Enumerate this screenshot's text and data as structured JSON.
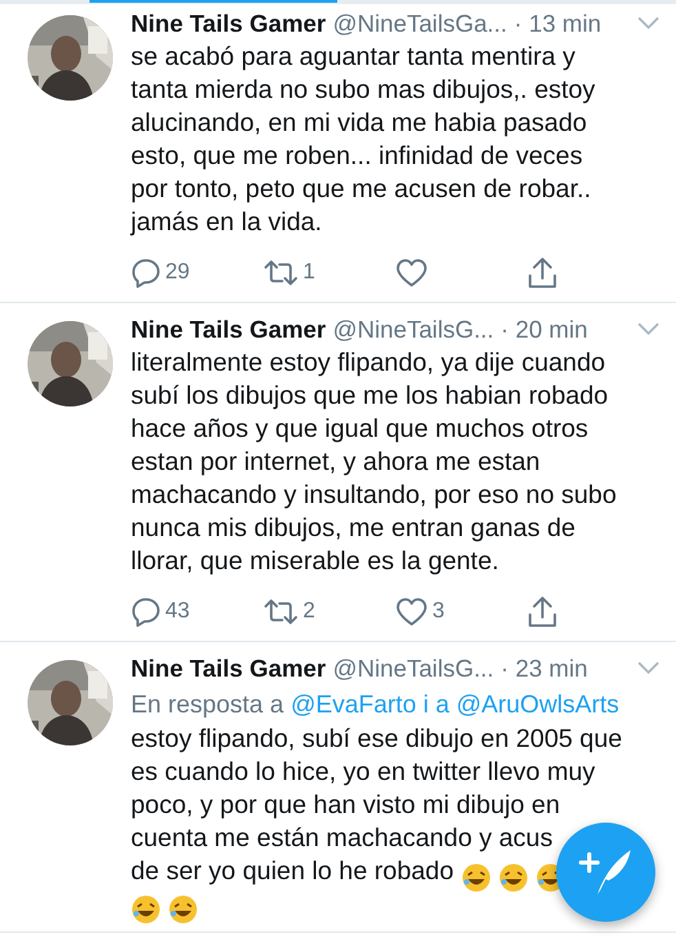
{
  "tweets": [
    {
      "name": "Nine Tails Gamer",
      "handle": "@NineTailsGa...",
      "time": "· 13 min",
      "lines": [
        "se acabó para aguantar tanta mentira y",
        "tanta mierda no subo mas dibujos,. estoy",
        "alucinando, en mi vida me habia pasado",
        "esto, que me roben...   infinidad de veces",
        "por tonto, peto que me acusen de robar..",
        "jamás en la vida."
      ],
      "actions": {
        "replies": "29",
        "retweets": "1"
      }
    },
    {
      "name": "Nine Tails Gamer",
      "handle": "@NineTailsG...",
      "time": "· 20 min",
      "lines": [
        "literalmente estoy flipando, ya dije cuando",
        "subí los dibujos que me los habian robado",
        "hace años y que igual que muchos otros",
        "estan por internet, y ahora me estan",
        "machacando y insultando, por eso no subo",
        "nunca mis dibujos, me entran ganas de",
        "llorar, que miserable es la gente."
      ],
      "actions": {
        "replies": "43",
        "retweets": "2",
        "likes": "3"
      }
    },
    {
      "name": "Nine Tails Gamer",
      "handle": "@NineTailsG...",
      "time": "· 23 min",
      "reply": {
        "prefix": "En resposta a",
        "mentions": "@EvaFarto i a @AruOwlsArts"
      },
      "lines": [
        "estoy flipando, subí ese dibujo en 2005 que",
        "es cuando lo hice, yo en twitter llevo muy",
        "poco, y por que han visto mi dibujo en",
        "cuenta me están machacando y acus",
        "de ser yo quien lo he robado"
      ],
      "emoji": [
        {
          "kind": "laughing"
        },
        {
          "kind": "laughing"
        },
        {
          "kind": "laughing"
        },
        {
          "kind": "laughing"
        },
        {
          "kind": "laughing"
        }
      ]
    }
  ],
  "compose_button": {
    "kind": "compose"
  }
}
